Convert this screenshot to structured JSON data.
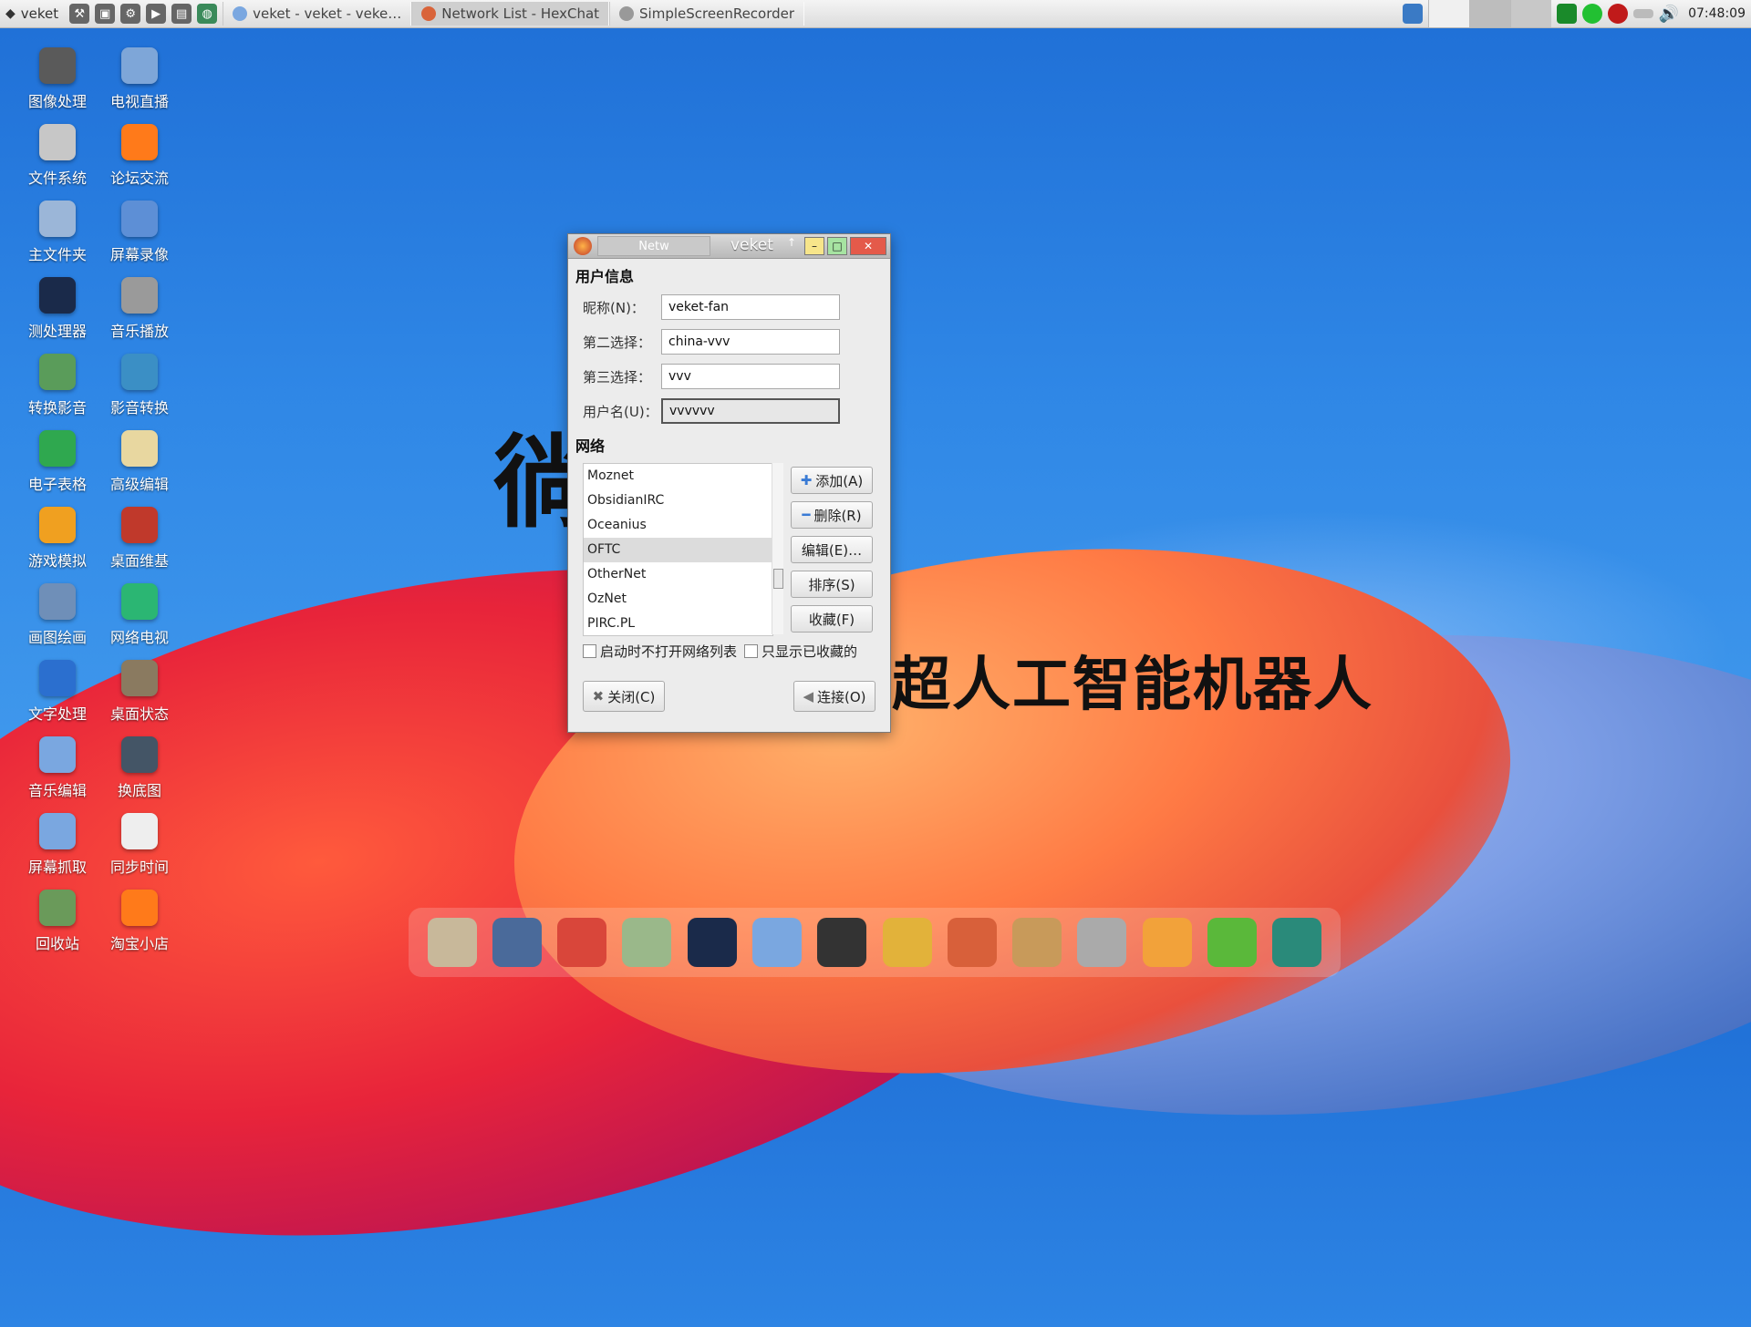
{
  "taskbar": {
    "start_label": "veket",
    "tasks": [
      {
        "label": "veket - veket - veke…"
      },
      {
        "label": "Network List - HexChat"
      },
      {
        "label": "SimpleScreenRecorder"
      }
    ],
    "clock": "07:48:09"
  },
  "desktop": {
    "icons": [
      {
        "label": "图像处理",
        "icon": "camera-icon",
        "color": "#5a5a5a"
      },
      {
        "label": "电视直播",
        "icon": "tv-icon",
        "color": "#7ea6d8"
      },
      {
        "label": "文件系统",
        "icon": "drive-icon",
        "color": "#c7c7c7"
      },
      {
        "label": "论坛交流",
        "icon": "browser-icon",
        "color": "#ff7a1a"
      },
      {
        "label": "主文件夹",
        "icon": "home-folder-icon",
        "color": "#9bb6d8"
      },
      {
        "label": "屏幕录像",
        "icon": "screen-record-icon",
        "color": "#5d8fd6"
      },
      {
        "label": "测处理器",
        "icon": "cpu-test-icon",
        "color": "#1a2a4a"
      },
      {
        "label": "音乐播放",
        "icon": "music-player-icon",
        "color": "#9a9a9a"
      },
      {
        "label": "转换影音",
        "icon": "convert-media-icon",
        "color": "#5a9c5a"
      },
      {
        "label": "影音转换",
        "icon": "media-convert-icon",
        "color": "#3b8fc5"
      },
      {
        "label": "电子表格",
        "icon": "spreadsheet-icon",
        "color": "#2fa84f"
      },
      {
        "label": "高级编辑",
        "icon": "editor-icon",
        "color": "#e8d7a0"
      },
      {
        "label": "游戏模拟",
        "icon": "game-icon",
        "color": "#f0a020"
      },
      {
        "label": "桌面维基",
        "icon": "wiki-icon",
        "color": "#c0392b"
      },
      {
        "label": "画图绘画",
        "icon": "paint-icon",
        "color": "#6f8fb8"
      },
      {
        "label": "网络电视",
        "icon": "play-icon",
        "color": "#2bb673"
      },
      {
        "label": "文字处理",
        "icon": "word-icon",
        "color": "#2b6fcf"
      },
      {
        "label": "桌面状态",
        "icon": "status-icon",
        "color": "#8a7a60"
      },
      {
        "label": "音乐编辑",
        "icon": "music-edit-icon",
        "color": "#7aa7e0"
      },
      {
        "label": "换底图",
        "icon": "wallpaper-icon",
        "color": "#445566"
      },
      {
        "label": "屏幕抓取",
        "icon": "screenshot-icon",
        "color": "#7aa7e0"
      },
      {
        "label": "同步时间",
        "icon": "calendar-icon",
        "color": "#eeeeee"
      },
      {
        "label": "回收站",
        "icon": "trash-icon",
        "color": "#6a9a5a"
      },
      {
        "label": "淘宝小店",
        "icon": "shop-icon",
        "color": "#ff7a1a"
      }
    ],
    "bg_text_1": "徜",
    "bg_text_2": "超人工智能机器人"
  },
  "dialog": {
    "title": "veket",
    "tab_label": "Netw",
    "user_section": "用户信息",
    "fields": [
      {
        "label": "昵称(N)：",
        "value": "veket-fan"
      },
      {
        "label": "第二选择：",
        "value": "china-vvv"
      },
      {
        "label": "第三选择：",
        "value": "vvv"
      },
      {
        "label": "用户名(U)：",
        "value": "vvvvvv"
      }
    ],
    "network_section": "网络",
    "networks": [
      {
        "name": "Moznet"
      },
      {
        "name": "ObsidianIRC"
      },
      {
        "name": "Oceanius"
      },
      {
        "name": "OFTC",
        "selected": true
      },
      {
        "name": "OtherNet"
      },
      {
        "name": "OzNet"
      },
      {
        "name": "PIRC.PL"
      }
    ],
    "buttons": {
      "add": "添加(A)",
      "remove": "删除(R)",
      "edit": "编辑(E)…",
      "sort": "排序(S)",
      "favorite": "收藏(F)",
      "close": "关闭(C)",
      "connect": "连接(O)"
    },
    "checkbox_skip": "启动时不打开网络列表",
    "checkbox_fav": "只显示已收藏的"
  },
  "dock": {
    "items": [
      {
        "icon": "file-manager-icon",
        "color": "#c8b89a"
      },
      {
        "icon": "monitor-icon",
        "color": "#4a6a9a"
      },
      {
        "icon": "pet-icon",
        "color": "#d9463a"
      },
      {
        "icon": "notepad-icon",
        "color": "#9ab88a"
      },
      {
        "icon": "media-player-icon",
        "color": "#1a2a4a"
      },
      {
        "icon": "users-icon",
        "color": "#7aa7e0"
      },
      {
        "icon": "penguin-icon",
        "color": "#333333"
      },
      {
        "icon": "book-icon",
        "color": "#e2b23a"
      },
      {
        "icon": "presentation-icon",
        "color": "#d8603a"
      },
      {
        "icon": "palette-icon",
        "color": "#c89a5a"
      },
      {
        "icon": "usb-icon",
        "color": "#aaaaaa"
      },
      {
        "icon": "mascot-icon",
        "color": "#f2a23a"
      },
      {
        "icon": "help-icon",
        "color": "#5ab83a"
      },
      {
        "icon": "camera-app-icon",
        "color": "#2a8a7a"
      }
    ]
  }
}
